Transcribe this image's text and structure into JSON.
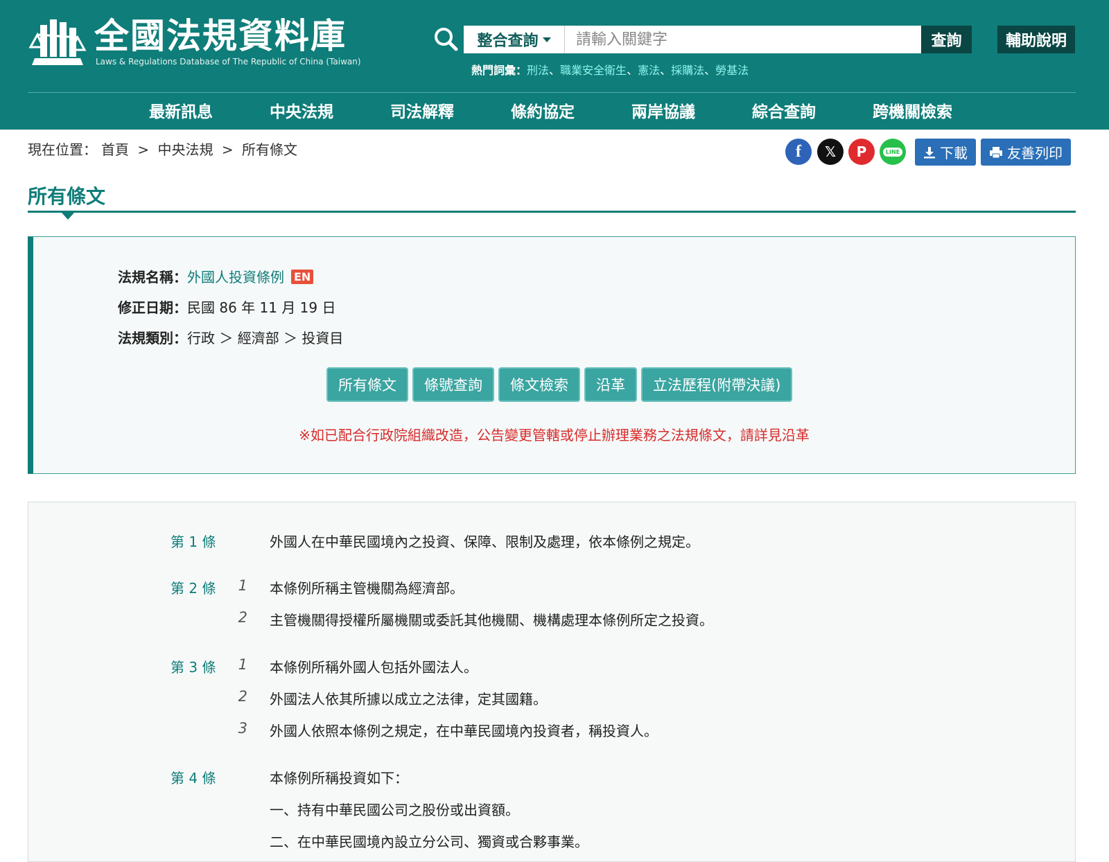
{
  "header": {
    "site_title": "全國法規資料庫",
    "site_subtitle": "Laws & Regulations Database of The Republic of China (Taiwan)",
    "search_scope": "整合查詢",
    "search_placeholder": "請輸入關鍵字",
    "query_button": "查詢",
    "help_button": "輔助說明",
    "hot_label": "熱門詞彙：",
    "hot_terms": [
      "刑法",
      "職業安全衛生",
      "憲法",
      "採購法",
      "勞基法"
    ],
    "hot_separator": "、"
  },
  "nav": {
    "items": [
      "最新訊息",
      "中央法規",
      "司法解釋",
      "條約協定",
      "兩岸協議",
      "綜合查詢",
      "跨機關檢索"
    ]
  },
  "breadcrumb": {
    "prefix": "現在位置：",
    "items": [
      "首頁",
      "中央法規",
      "所有條文"
    ],
    "separator": ">"
  },
  "toolbar": {
    "download": "下載",
    "print": "友善列印",
    "line_label": "LINE"
  },
  "page_title": "所有條文",
  "law_info": {
    "name_label": "法規名稱：",
    "name": "外國人投資條例",
    "en_badge": "EN",
    "date_label": "修正日期：",
    "date": "民國 86 年 11 月 19 日",
    "category_label": "法規類別：",
    "category": "行政 ＞ 經濟部 ＞ 投資目"
  },
  "tabs": [
    "所有條文",
    "條號查詢",
    "條文檢索",
    "沿革",
    "立法歷程(附帶決議)"
  ],
  "notice": "※如已配合行政院組織改造，公告變更管轄或停止辦理業務之法規條文，請詳見沿革",
  "articles": [
    {
      "no": "第 1 條",
      "paras": [
        {
          "idx": "",
          "text": "外國人在中華民國境內之投資、保障、限制及處理，依本條例之規定。"
        }
      ]
    },
    {
      "no": "第 2 條",
      "paras": [
        {
          "idx": "1",
          "text": "本條例所稱主管機關為經濟部。"
        },
        {
          "idx": "2",
          "text": "主管機關得授權所屬機關或委託其他機關、機構處理本條例所定之投資。"
        }
      ]
    },
    {
      "no": "第 3 條",
      "paras": [
        {
          "idx": "1",
          "text": "本條例所稱外國人包括外國法人。"
        },
        {
          "idx": "2",
          "text": "外國法人依其所據以成立之法律，定其國籍。"
        },
        {
          "idx": "3",
          "text": "外國人依照本條例之規定，在中華民國境內投資者，稱投資人。"
        }
      ]
    },
    {
      "no": "第 4 條",
      "paras": [
        {
          "idx": "",
          "text": "本條例所稱投資如下："
        },
        {
          "idx": "",
          "text": "一、持有中華民國公司之股份或出資額。"
        },
        {
          "idx": "",
          "text": "二、在中華民國境內設立分公司、獨資或合夥事業。"
        }
      ]
    }
  ]
}
